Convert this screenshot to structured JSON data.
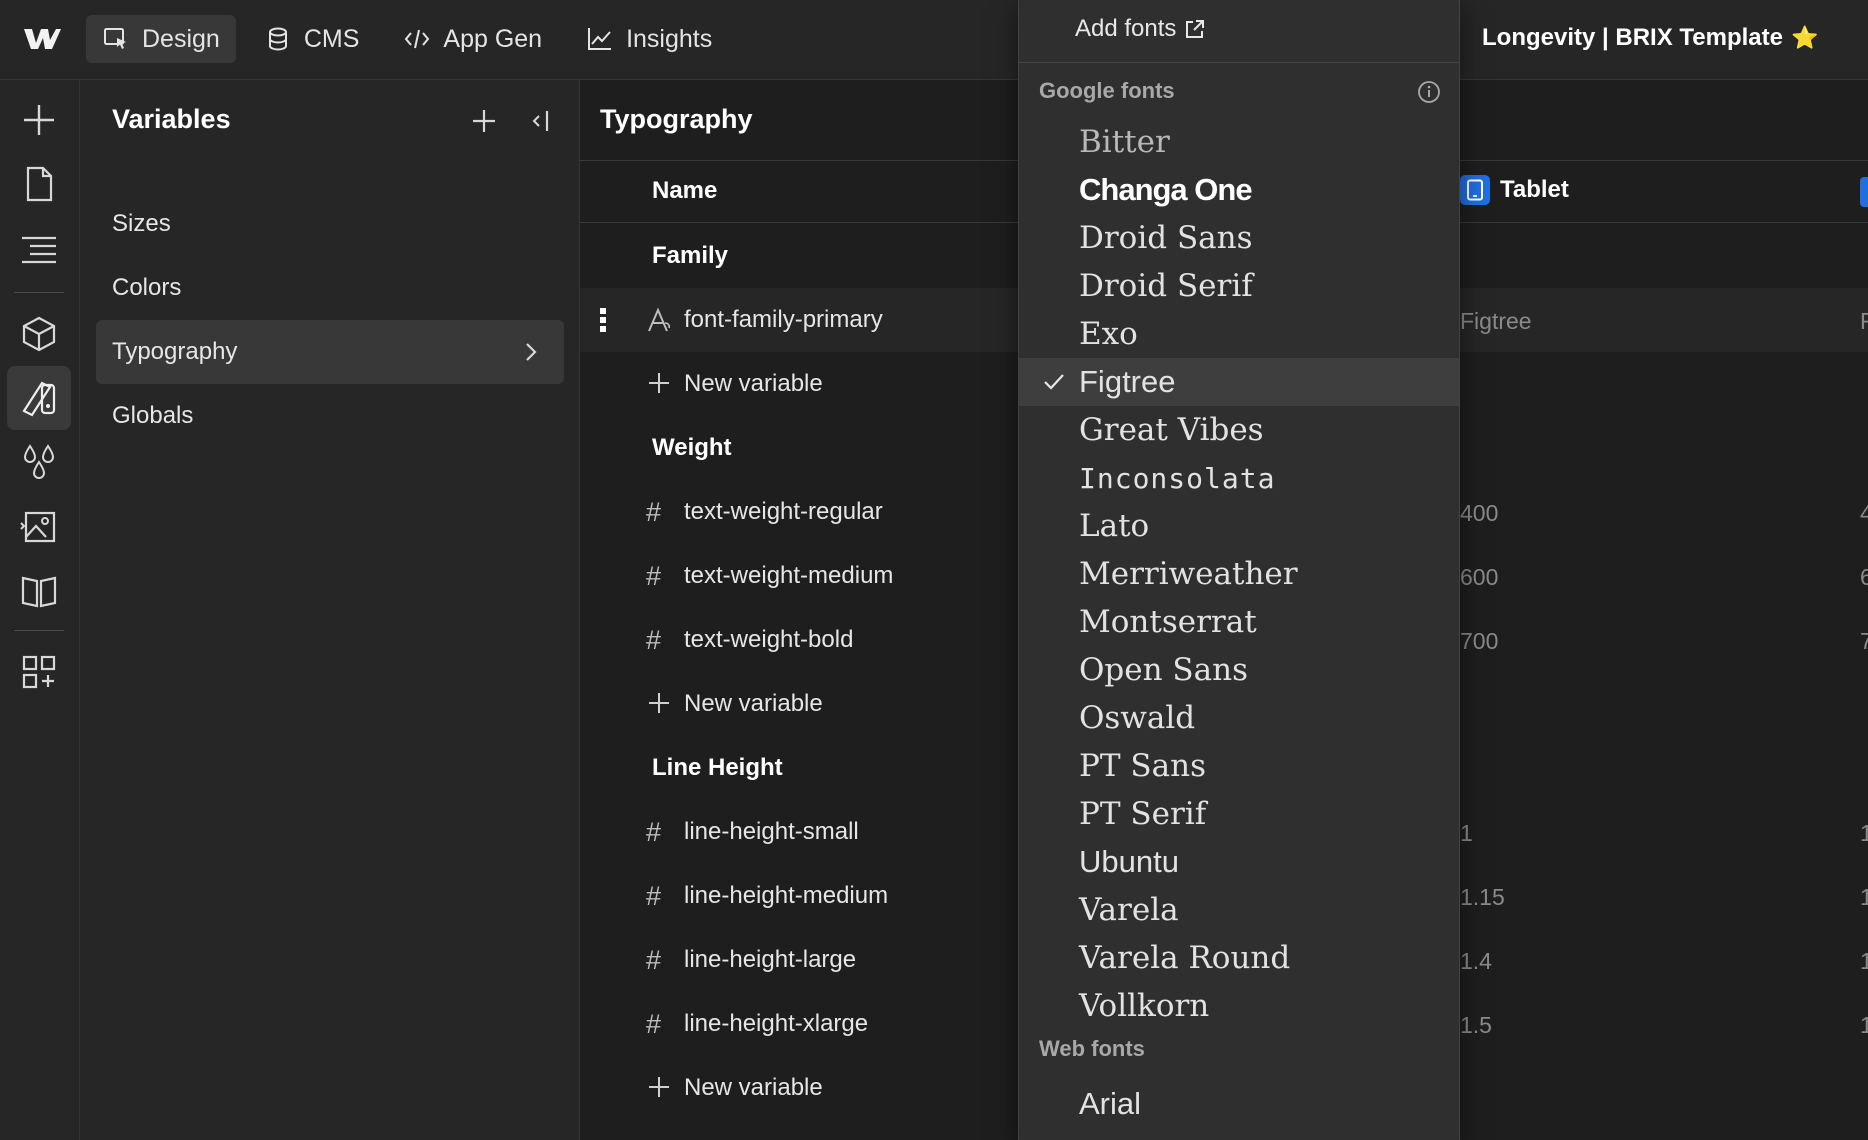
{
  "topbar": {
    "tabs": [
      {
        "label": "Design",
        "icon": "cursor-select-icon",
        "active": true
      },
      {
        "label": "CMS",
        "icon": "database-icon"
      },
      {
        "label": "App Gen",
        "icon": "code-icon"
      },
      {
        "label": "Insights",
        "icon": "chart-line-icon"
      }
    ],
    "project_title": "Longevity | BRIX Template",
    "star": "⭐"
  },
  "rail": {
    "icons": [
      "add-icon",
      "page-icon",
      "navigator-icon",
      "components-icon",
      "style-icon",
      "variables-icon",
      "assets-icon",
      "library-icon",
      "apps-icon"
    ],
    "active": "style-icon"
  },
  "variables_panel": {
    "title": "Variables",
    "items": [
      {
        "label": "Sizes"
      },
      {
        "label": "Colors"
      },
      {
        "label": "Typography",
        "active": true
      },
      {
        "label": "Globals"
      }
    ]
  },
  "main": {
    "title": "Typography",
    "col_name": "Name",
    "col_tablet": "Tablet",
    "rows": [
      {
        "type": "group",
        "label": "Family"
      },
      {
        "type": "var",
        "icon": "font-icon",
        "label": "font-family-primary",
        "tablet": "Figtree",
        "extra": "F"
      },
      {
        "type": "new",
        "label": "New variable"
      },
      {
        "type": "group",
        "label": "Weight"
      },
      {
        "type": "var",
        "icon": "hash-icon",
        "label": "text-weight-regular",
        "tablet": "400",
        "extra": "4"
      },
      {
        "type": "var",
        "icon": "hash-icon",
        "label": "text-weight-medium",
        "tablet": "600",
        "extra": "6"
      },
      {
        "type": "var",
        "icon": "hash-icon",
        "label": "text-weight-bold",
        "tablet": "700",
        "extra": "7"
      },
      {
        "type": "new",
        "label": "New variable"
      },
      {
        "type": "group",
        "label": "Line Height"
      },
      {
        "type": "var",
        "icon": "hash-icon",
        "label": "line-height-small",
        "tablet": "1",
        "extra": "1"
      },
      {
        "type": "var",
        "icon": "hash-icon",
        "label": "line-height-medium",
        "tablet": "1.15",
        "extra": "1"
      },
      {
        "type": "var",
        "icon": "hash-icon",
        "label": "line-height-large",
        "tablet": "1.4",
        "extra": "1"
      },
      {
        "type": "var",
        "icon": "hash-icon",
        "label": "line-height-xlarge",
        "tablet": "1.5",
        "extra": "1"
      },
      {
        "type": "new",
        "label": "New variable"
      }
    ]
  },
  "dropdown": {
    "add_fonts": "Add fonts",
    "google_label": "Google fonts",
    "web_label": "Web fonts",
    "google_fonts": [
      {
        "name": "Bitter",
        "style": "dim"
      },
      {
        "name": "Changa One",
        "style": "bold"
      },
      {
        "name": "Droid Sans"
      },
      {
        "name": "Droid Serif"
      },
      {
        "name": "Exo"
      },
      {
        "name": "Figtree",
        "style": "sans",
        "selected": true
      },
      {
        "name": "Great Vibes"
      },
      {
        "name": "Inconsolata",
        "style": "mono"
      },
      {
        "name": "Lato"
      },
      {
        "name": "Merriweather"
      },
      {
        "name": "Montserrat"
      },
      {
        "name": "Open Sans"
      },
      {
        "name": "Oswald"
      },
      {
        "name": "PT Sans"
      },
      {
        "name": "PT Serif"
      },
      {
        "name": "Ubuntu",
        "style": "sans"
      },
      {
        "name": "Varela"
      },
      {
        "name": "Varela Round"
      },
      {
        "name": "Vollkorn"
      }
    ],
    "web_fonts": [
      {
        "name": "Arial",
        "style": "sans"
      }
    ]
  }
}
